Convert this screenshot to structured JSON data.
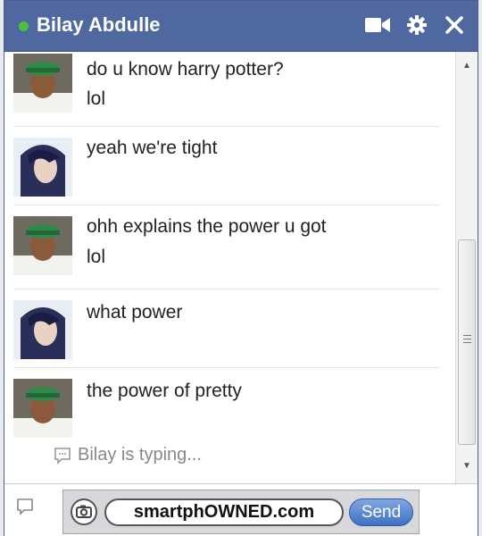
{
  "chat": {
    "contact_name": "Bilay Abdulle",
    "status": "online",
    "icons": [
      "video-camera-icon",
      "gear-icon",
      "close-icon"
    ]
  },
  "messages": [
    {
      "sender": "Bilay Abdulle",
      "lines": [
        "do u know harry potter?",
        "lol"
      ]
    },
    {
      "sender": "me",
      "lines": [
        "yeah we're tight"
      ]
    },
    {
      "sender": "Bilay Abdulle",
      "lines": [
        "ohh explains the power u got",
        "lol"
      ]
    },
    {
      "sender": "me",
      "lines": [
        "what power"
      ]
    },
    {
      "sender": "Bilay Abdulle",
      "lines": [
        "the power of pretty"
      ]
    }
  ],
  "typing_indicator": "Bilay is typing...",
  "input": {
    "value": "",
    "placeholder": ""
  },
  "watermark": {
    "site": "smartphOWNED.com",
    "send_label": "Send"
  },
  "colors": {
    "titlebar": "#4f68a0",
    "online": "#4ac13b",
    "send": "#3f72c4"
  }
}
